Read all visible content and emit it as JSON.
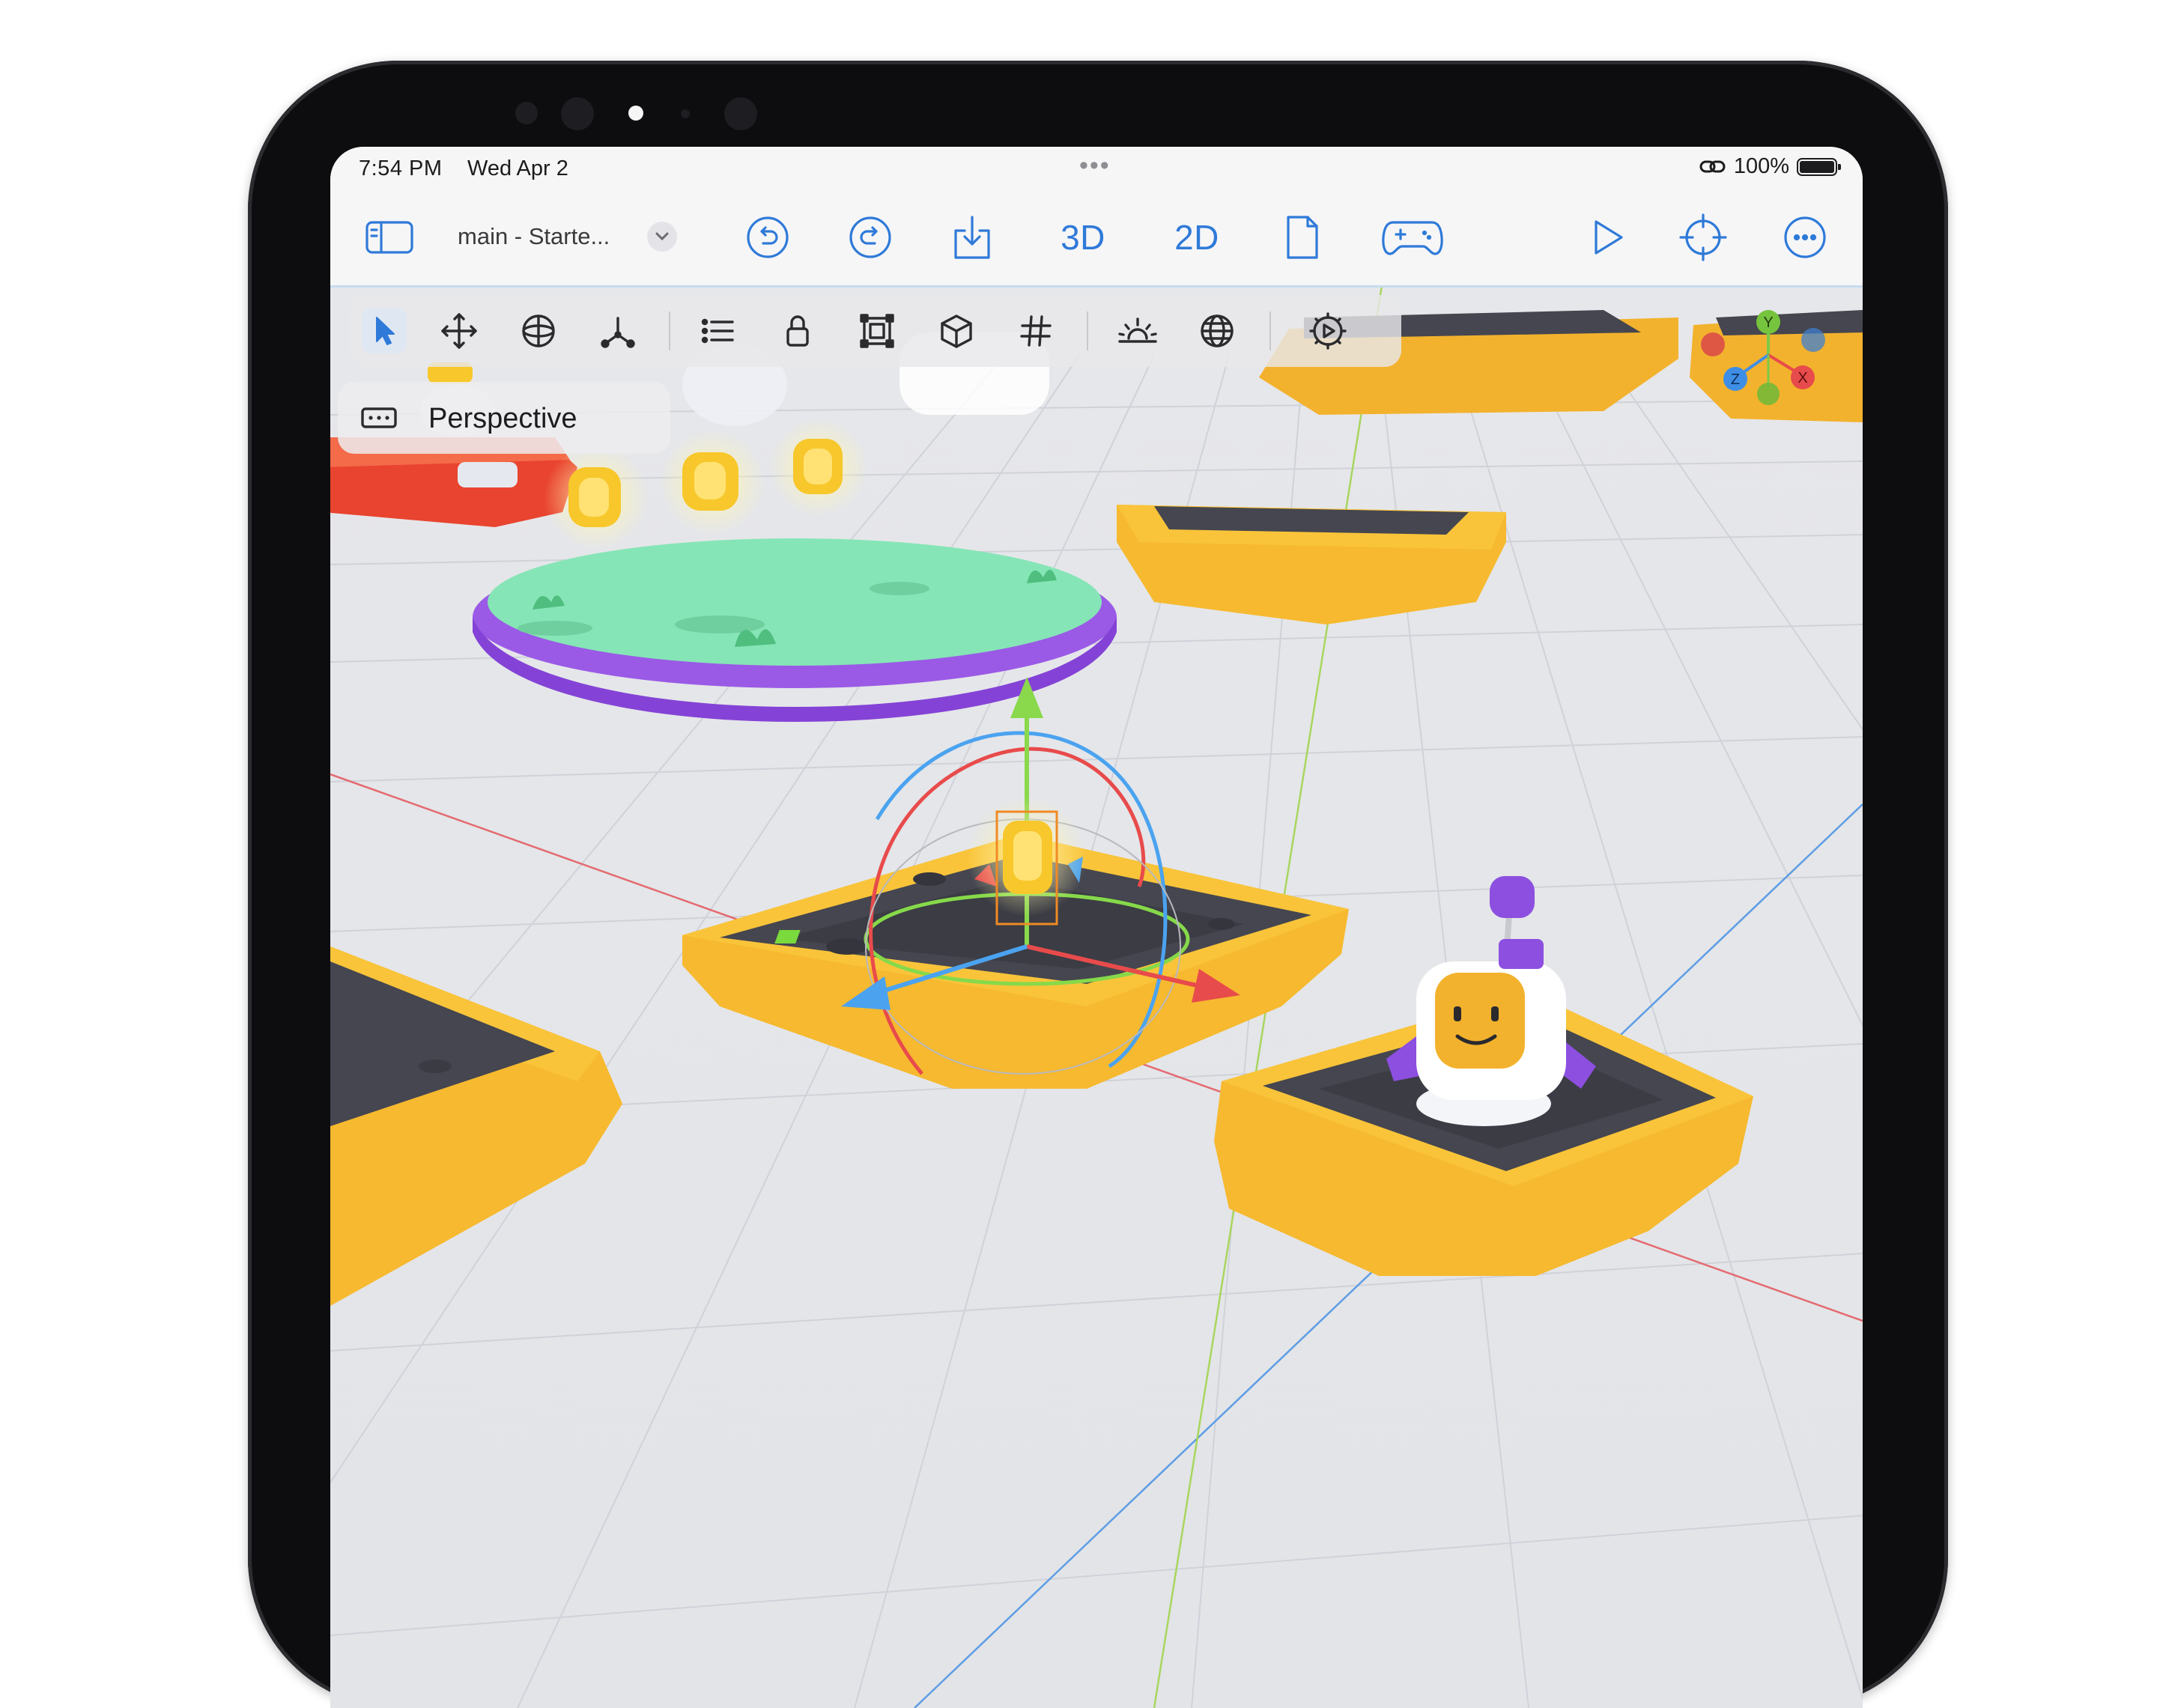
{
  "status_bar": {
    "time": "7:54 PM",
    "date": "Wed Apr 2",
    "battery": "100%"
  },
  "nav": {
    "document_title": "main - Starte...",
    "mode_3d": "3D",
    "mode_2d": "2D"
  },
  "viewport": {
    "camera_mode": "Perspective",
    "gizmo_axes": {
      "y": "Y",
      "x": "X",
      "z": "Z"
    },
    "active_tool": "select"
  },
  "colors": {
    "accent": "#2f7ad8",
    "platform_yellow": "#f6b92f",
    "platform_top": "#45464f",
    "island_green": "#86e5b6",
    "island_purple": "#9a5ae6"
  }
}
